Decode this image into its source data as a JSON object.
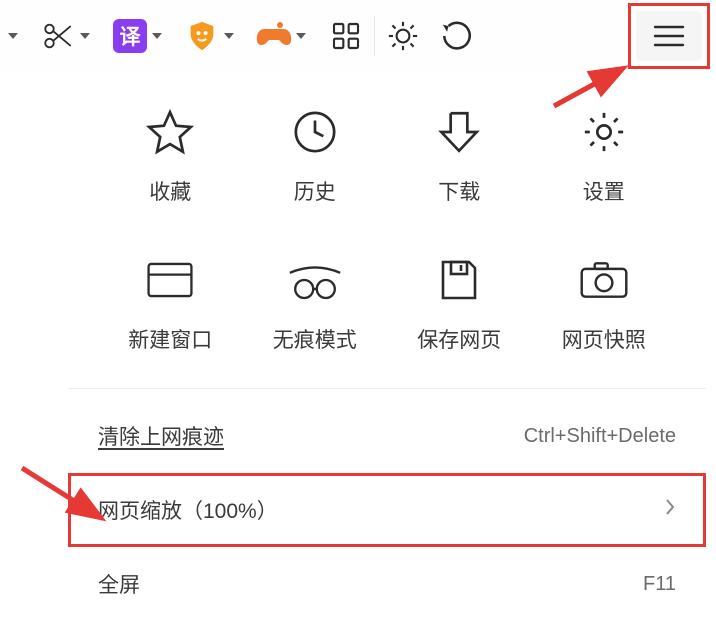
{
  "toolbar": {
    "items": [
      {
        "name": "scissors-icon",
        "hasDrop": true
      },
      {
        "name": "translate-icon",
        "hasDrop": true
      },
      {
        "name": "shield-icon",
        "hasDrop": true
      },
      {
        "name": "game-icon",
        "hasDrop": true
      },
      {
        "name": "grid-icon",
        "hasDrop": false
      },
      {
        "name": "brightness-icon",
        "hasDrop": false
      },
      {
        "name": "undo-icon",
        "hasDrop": false
      }
    ],
    "translate_glyph": "译"
  },
  "menu": {
    "grid": [
      {
        "name": "favorites",
        "icon": "star-icon",
        "label": "收藏"
      },
      {
        "name": "history",
        "icon": "clock-icon",
        "label": "历史"
      },
      {
        "name": "downloads",
        "icon": "download-icon",
        "label": "下载"
      },
      {
        "name": "settings",
        "icon": "gear-icon",
        "label": "设置"
      },
      {
        "name": "new-window",
        "icon": "window-icon",
        "label": "新建窗口"
      },
      {
        "name": "incognito",
        "icon": "incognito-icon",
        "label": "无痕模式"
      },
      {
        "name": "save-page",
        "icon": "save-icon",
        "label": "保存网页"
      },
      {
        "name": "snapshot",
        "icon": "camera-icon",
        "label": "网页快照"
      }
    ],
    "rows": {
      "clear": {
        "label": "清除上网痕迹",
        "shortcut": "Ctrl+Shift+Delete"
      },
      "zoom": {
        "label": "网页缩放（100%）"
      },
      "fullscreen": {
        "label": "全屏",
        "shortcut": "F11"
      }
    }
  }
}
